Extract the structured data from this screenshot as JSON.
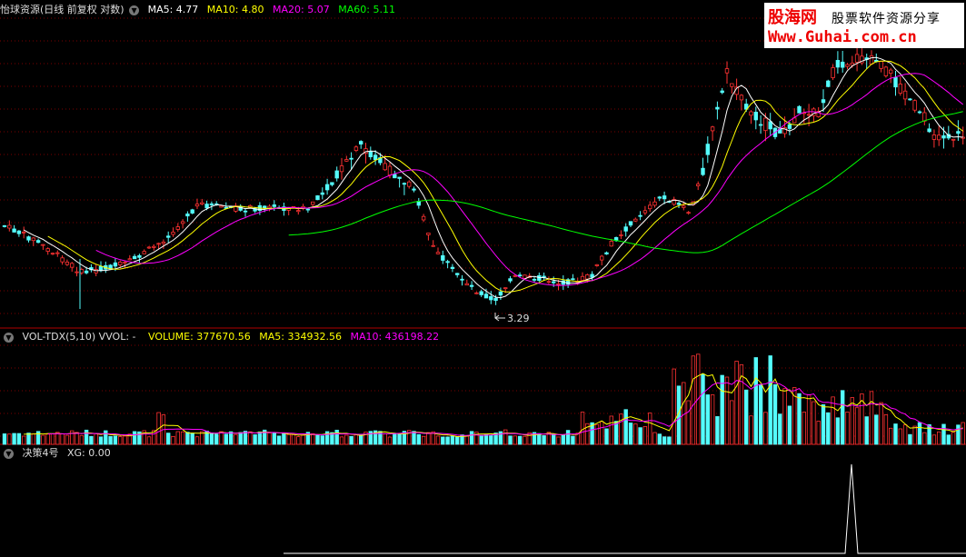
{
  "main_panel": {
    "title": "怡球资源(日线 前复权 对数)",
    "ma5_label": "MA5: 4.77",
    "ma10_label": "MA10: 4.80",
    "ma20_label": "MA20: 5.07",
    "ma60_label": "MA60: 5.11",
    "low_marker": "3.29"
  },
  "vol_panel": {
    "title": "VOL-TDX(5,10) VVOL: -",
    "volume_label": "VOLUME: 377670.56",
    "ma5_label": "MA5: 334932.56",
    "ma10_label": "MA10: 436198.22"
  },
  "signal_panel": {
    "title": "决策4号",
    "xg_label": "XG: 0.00"
  },
  "watermark": {
    "brand": "股海网",
    "slogan": "股票软件资源分享",
    "url": "Www.Guhai.com.cn"
  },
  "colors": {
    "up": "#ff3232",
    "down": "#54fcfc",
    "ma5": "#ffffff",
    "ma10": "#ffff00",
    "ma20": "#ff00ff",
    "ma60": "#00ff00",
    "grid": "#7a0000"
  }
}
